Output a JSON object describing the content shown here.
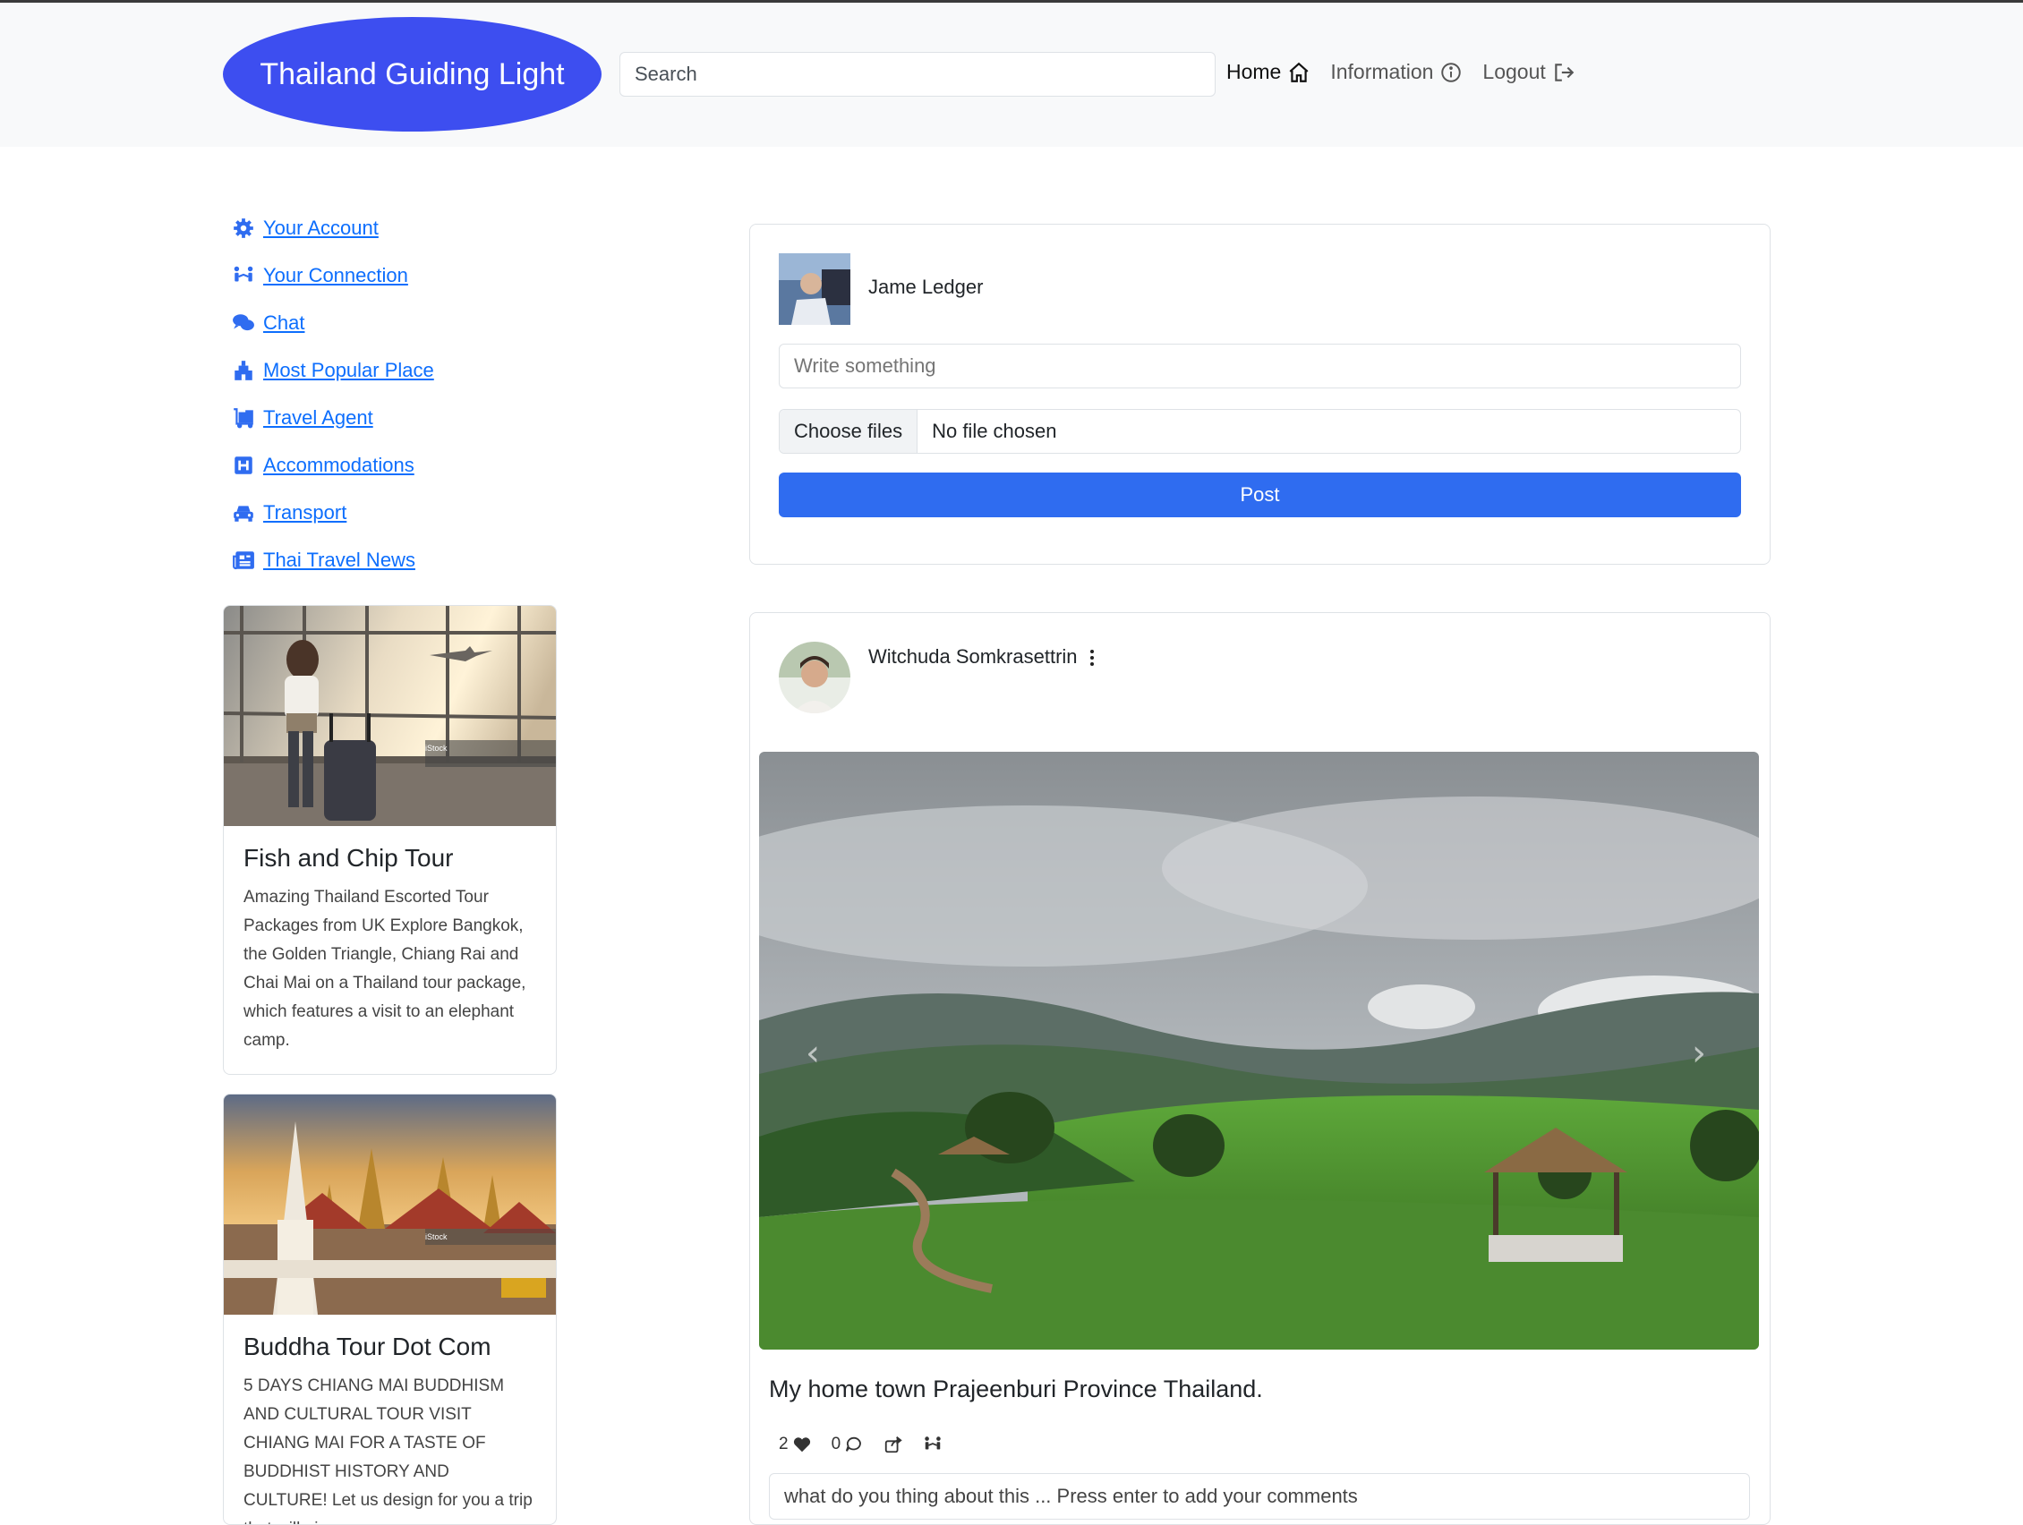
{
  "navbar": {
    "brand": "Thailand Guiding Light",
    "search_placeholder": "Search",
    "links": {
      "home": "Home",
      "information": "Information",
      "logout": "Logout"
    }
  },
  "sidebar": {
    "items": [
      {
        "label": "Your Account",
        "icon": "gear-icon"
      },
      {
        "label": "Your Connection",
        "icon": "people-icon"
      },
      {
        "label": "Chat",
        "icon": "chat-icon"
      },
      {
        "label": "Most Popular Place",
        "icon": "landmark-icon"
      },
      {
        "label": "Travel Agent",
        "icon": "luggage-icon"
      },
      {
        "label": "Accommodations",
        "icon": "hotel-icon"
      },
      {
        "label": "Transport",
        "icon": "car-icon"
      },
      {
        "label": "Thai Travel News",
        "icon": "newspaper-icon"
      }
    ]
  },
  "ads": [
    {
      "title": "Fish and Chip Tour",
      "text": "Amazing Thailand Escorted Tour Packages from UK Explore Bangkok, the Golden Triangle, Chiang Rai and Chai Mai on a Thailand tour package, which features a visit to an elephant camp.",
      "image_watermark": "iStock"
    },
    {
      "title": "Buddha Tour Dot Com",
      "text": "5 DAYS CHIANG MAI BUDDHISM AND CULTURAL TOUR VISIT CHIANG MAI FOR A TASTE OF BUDDHIST HISTORY AND CULTURE! Let us design for you a trip that will give you",
      "image_watermark": "iStock"
    }
  ],
  "composer": {
    "user_name": "Jame Ledger",
    "text_placeholder": "Write something",
    "file_button": "Choose files",
    "file_status": "No file chosen",
    "post_button": "Post"
  },
  "post": {
    "author": "Witchuda Somkrasettrin",
    "caption": "My home town Prajeenburi Province Thailand.",
    "likes": "2",
    "comments": "0",
    "comment_placeholder": "what do you thing about this ... Press enter to add your comments"
  },
  "colors": {
    "brand": "#3d4ef0",
    "link": "#0d6efd",
    "primary_button": "#2f6cf0"
  }
}
